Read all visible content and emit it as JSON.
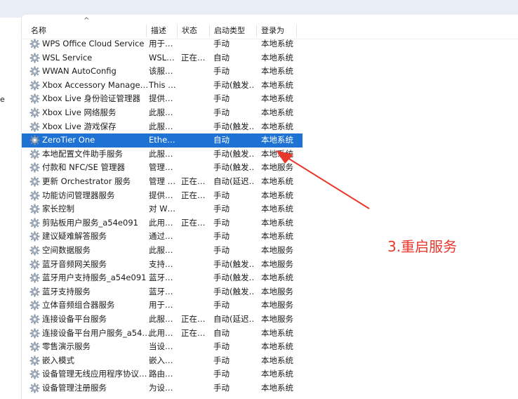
{
  "left_pane": {
    "fragment": "e"
  },
  "columns": {
    "name": "名称",
    "desc": "描述",
    "status": "状态",
    "startup": "启动类型",
    "logon": "登录为"
  },
  "services": [
    {
      "name": "WPS Office Cloud Service",
      "desc": "用于…",
      "status": "",
      "startup": "手动",
      "logon": "本地系统"
    },
    {
      "name": "WSL Service",
      "desc": "WSL…",
      "status": "正在…",
      "startup": "自动",
      "logon": "本地系统"
    },
    {
      "name": "WWAN AutoConfig",
      "desc": "该服…",
      "status": "",
      "startup": "手动",
      "logon": "本地系统"
    },
    {
      "name": "Xbox Accessory Manage…",
      "desc": "This …",
      "status": "",
      "startup": "手动(触发…",
      "logon": "本地系统"
    },
    {
      "name": "Xbox Live 身份验证管理器",
      "desc": "提供…",
      "status": "",
      "startup": "手动",
      "logon": "本地系统"
    },
    {
      "name": "Xbox Live 网络服务",
      "desc": "此服…",
      "status": "",
      "startup": "手动",
      "logon": "本地系统"
    },
    {
      "name": "Xbox Live 游戏保存",
      "desc": "此服…",
      "status": "",
      "startup": "手动(触发…",
      "logon": "本地系统"
    },
    {
      "name": "ZeroTier One",
      "desc": "Ethe…",
      "status": "",
      "startup": "自动",
      "logon": "本地系统"
    },
    {
      "name": "本地配置文件助手服务",
      "desc": "此服…",
      "status": "",
      "startup": "手动(触发…",
      "logon": "本地系统"
    },
    {
      "name": "付款和 NFC/SE 管理器",
      "desc": "管理…",
      "status": "",
      "startup": "手动(触发…",
      "logon": "本地服务"
    },
    {
      "name": "更新 Orchestrator 服务",
      "desc": "管理 …",
      "status": "正在…",
      "startup": "自动(延迟…",
      "logon": "本地系统"
    },
    {
      "name": "功能访问管理器服务",
      "desc": "提供…",
      "status": "正在…",
      "startup": "手动",
      "logon": "本地系统"
    },
    {
      "name": "家长控制",
      "desc": "对 W…",
      "status": "",
      "startup": "手动",
      "logon": "本地系统"
    },
    {
      "name": "剪贴板用户服务_a54e091",
      "desc": "此用…",
      "status": "正在…",
      "startup": "手动",
      "logon": "本地系统"
    },
    {
      "name": "建议疑难解答服务",
      "desc": "通过…",
      "status": "",
      "startup": "手动",
      "logon": "本地系统"
    },
    {
      "name": "空间数据服务",
      "desc": "此服…",
      "status": "",
      "startup": "手动",
      "logon": "本地服务"
    },
    {
      "name": "蓝牙音频网关服务",
      "desc": "支持…",
      "status": "",
      "startup": "手动(触发…",
      "logon": "本地服务"
    },
    {
      "name": "蓝牙用户支持服务_a54e091",
      "desc": "蓝牙…",
      "status": "",
      "startup": "手动(触发…",
      "logon": "本地系统"
    },
    {
      "name": "蓝牙支持服务",
      "desc": "蓝牙…",
      "status": "",
      "startup": "手动(触发…",
      "logon": "本地服务"
    },
    {
      "name": "立体音频组合器服务",
      "desc": "用于…",
      "status": "",
      "startup": "手动",
      "logon": "本地服务"
    },
    {
      "name": "连接设备平台服务",
      "desc": "此服…",
      "status": "正在…",
      "startup": "自动(延迟…",
      "logon": "本地服务"
    },
    {
      "name": "连接设备平台用户服务_a54…",
      "desc": "此用…",
      "status": "正在…",
      "startup": "自动",
      "logon": "本地系统"
    },
    {
      "name": "零售演示服务",
      "desc": "当设…",
      "status": "",
      "startup": "手动",
      "logon": "本地系统"
    },
    {
      "name": "嵌入模式",
      "desc": "嵌入…",
      "status": "",
      "startup": "手动",
      "logon": "本地系统"
    },
    {
      "name": "设备管理无线应用程序协议…",
      "desc": "路由…",
      "status": "",
      "startup": "手动",
      "logon": "本地系统"
    },
    {
      "name": "设备管理注册服务",
      "desc": "为设…",
      "status": "",
      "startup": "手动",
      "logon": "本地系统"
    }
  ],
  "selected_index": 7,
  "annotation": {
    "text": "3.重启服务",
    "color": "#e8372b"
  },
  "colors": {
    "selection": "#1e72d3",
    "annotation": "#e8372b"
  },
  "icons": {
    "service_row": "gear-icon",
    "sort": "sort-ascending-icon"
  }
}
